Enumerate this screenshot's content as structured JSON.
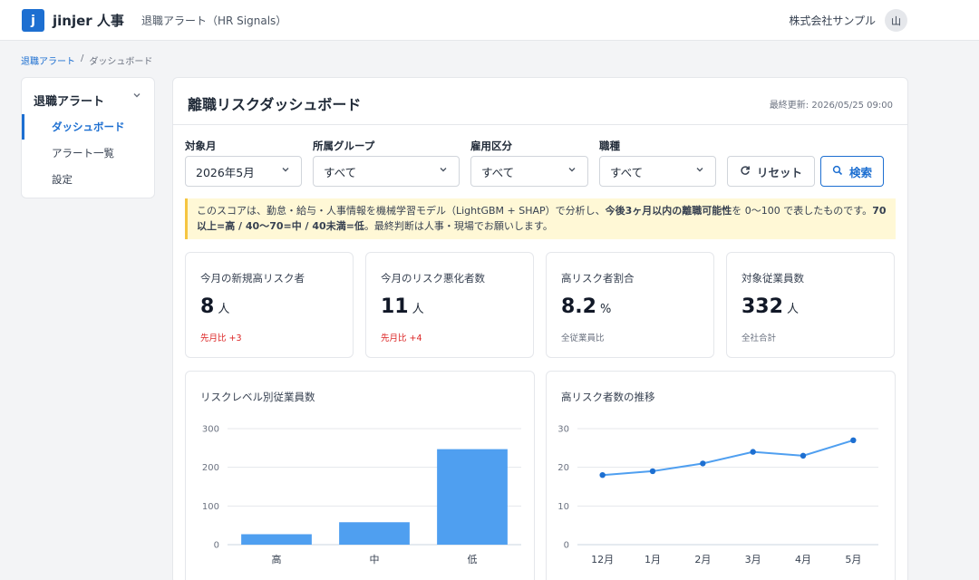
{
  "header": {
    "logo_letter": "j",
    "logo_text": "jinjer 人事",
    "app_title": "退職アラート（HR Signals）",
    "company": "株式会社サンプル",
    "avatar": "山"
  },
  "breadcrumb": {
    "root": "退職アラート",
    "sep": "/",
    "current": "ダッシュボード"
  },
  "sidebar": {
    "heading": "退職アラート",
    "items": [
      {
        "label": "ダッシュボード",
        "active": true
      },
      {
        "label": "アラート一覧"
      },
      {
        "label": "設定"
      }
    ]
  },
  "main": {
    "title": "離職リスクダッシュボード",
    "updated": "最終更新: 2026/05/25 09:00"
  },
  "filters": {
    "month": {
      "label": "対象月",
      "value": "2026年5月"
    },
    "group": {
      "label": "所属グループ",
      "value": "すべて"
    },
    "employment": {
      "label": "雇用区分",
      "value": "すべて"
    },
    "job": {
      "label": "職種",
      "value": "すべて"
    },
    "reset_label": "リセット",
    "search_label": "検索"
  },
  "notice": {
    "t1": "このスコアは、勤怠・給与・人事情報を機械学習モデル（LightGBM + SHAP）で分析し、",
    "b1": "今後3ヶ月以内の離職可能性",
    "t2": "を 0〜100 で表したものです。",
    "b2": "70以上=高 / 40〜70=中 / 40未満=低",
    "t3": "。最終判断は人事・現場でお願いします。"
  },
  "kpis": [
    {
      "title": "今月の新規高リスク者",
      "value": "8",
      "unit": "人",
      "sub": "先月比 +3"
    },
    {
      "title": "今月のリスク悪化者数",
      "value": "11",
      "unit": "人",
      "sub": "先月比 +4"
    },
    {
      "title": "高リスク者割合",
      "value": "8.2",
      "unit": "%",
      "sub": "全従業員比"
    },
    {
      "title": "対象従業員数",
      "value": "332",
      "unit": "人",
      "sub": "全社合計"
    }
  ],
  "colors": {
    "accent": "#1d6fd1",
    "bar": "#4f9ff0",
    "line": "#4f9ff0",
    "point": "#1d6fd1",
    "negative": "#dc2626",
    "notice_bg": "#fff8d6"
  },
  "chart_data": [
    {
      "type": "bar",
      "title": "リスクレベル別従業員数",
      "categories": [
        "高",
        "中",
        "低"
      ],
      "values": [
        27,
        58,
        247
      ],
      "ylim": [
        0,
        300
      ],
      "yticks": [
        0,
        100,
        200,
        300
      ],
      "grid": true
    },
    {
      "type": "line",
      "title": "高リスク者数の推移",
      "categories": [
        "12月",
        "1月",
        "2月",
        "3月",
        "4月",
        "5月"
      ],
      "values": [
        18,
        19,
        21,
        24,
        23,
        27
      ],
      "ylim": [
        0,
        30
      ],
      "yticks": [
        0,
        10,
        20,
        30
      ],
      "grid": true
    }
  ]
}
